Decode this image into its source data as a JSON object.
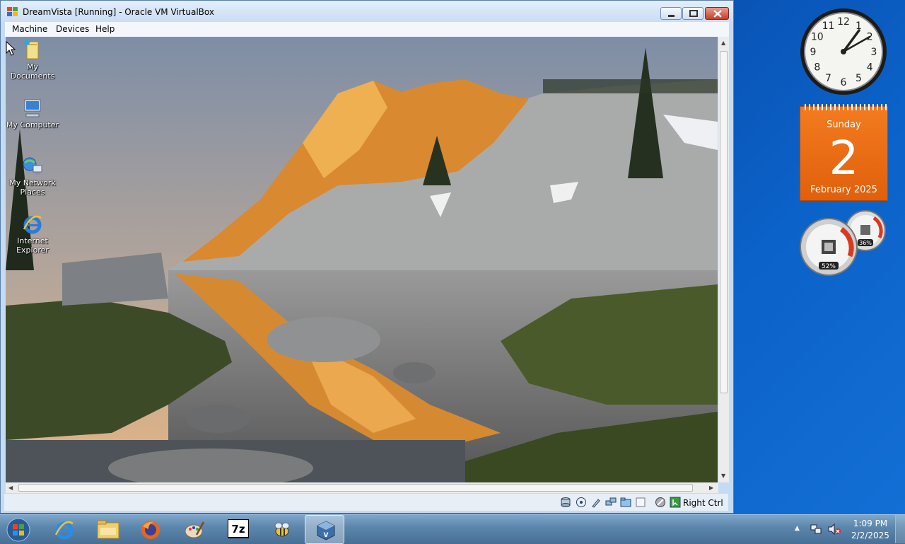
{
  "window": {
    "title": "DreamVista [Running] - Oracle VM VirtualBox",
    "menus": [
      "Machine",
      "Devices",
      "Help"
    ],
    "host_key": "Right Ctrl"
  },
  "desktop_icons": [
    {
      "label1": "My Documents",
      "label2": ""
    },
    {
      "label1": "My Computer",
      "label2": ""
    },
    {
      "label1": "My Network",
      "label2": "Places"
    },
    {
      "label1": "Internet",
      "label2": "Explorer"
    }
  ],
  "gadgets": {
    "clock": {
      "numerals": [
        "12",
        "1",
        "2",
        "3",
        "4",
        "5",
        "6",
        "7",
        "8",
        "9",
        "10",
        "11"
      ]
    },
    "calendar": {
      "day": "Sunday",
      "date": "2",
      "month_year": "February 2025"
    },
    "cpu_meter": {
      "cpu": "52%",
      "memory": "36%"
    }
  },
  "taskbar": {
    "time": "1:09 PM",
    "date": "2/2/2025"
  },
  "colors": {
    "desktop": "#0b5ec4",
    "calendar": "#ea6b15",
    "close_button": "#c63e26"
  }
}
